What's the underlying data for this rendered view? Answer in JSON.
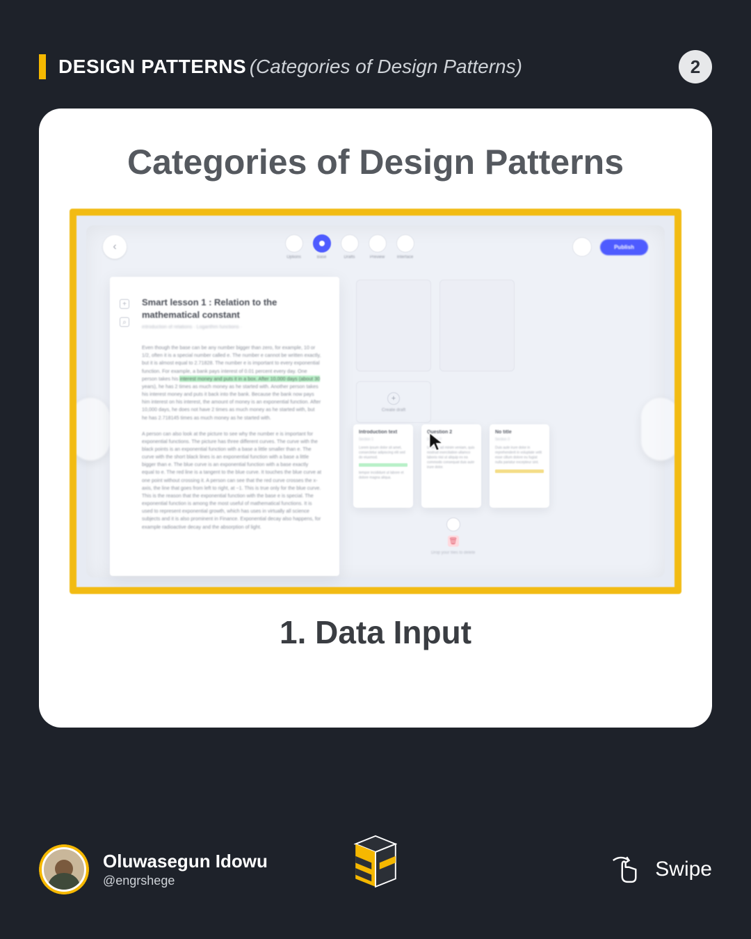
{
  "header": {
    "title": "DESIGN PATTERNS",
    "subtitle": "(Categories of Design Patterns)",
    "page_number": "2"
  },
  "card": {
    "title": "Categories of Design Patterns",
    "caption": "1. Data Input"
  },
  "mockup": {
    "tabs": [
      "Options",
      "Base",
      "Drafts",
      "Preview",
      "Interface"
    ],
    "publish_label": "Publish",
    "doc_title": "Smart lesson 1 : Relation to the mathematical constant",
    "doc_subtitle": "introduction of relations · Logarithm functions ·",
    "create_draft_label": "Create draft",
    "minicards": [
      {
        "title": "Introduction text",
        "sub": "Section 1"
      },
      {
        "title": "Question 2",
        "sub": "Section 2"
      },
      {
        "title": "No title",
        "sub": "Section 3"
      }
    ],
    "drop_label": "Drop your files to delete"
  },
  "footer": {
    "author_name": "Oluwasegun Idowu",
    "author_handle": "@engrshege",
    "swipe_label": "Swipe"
  }
}
